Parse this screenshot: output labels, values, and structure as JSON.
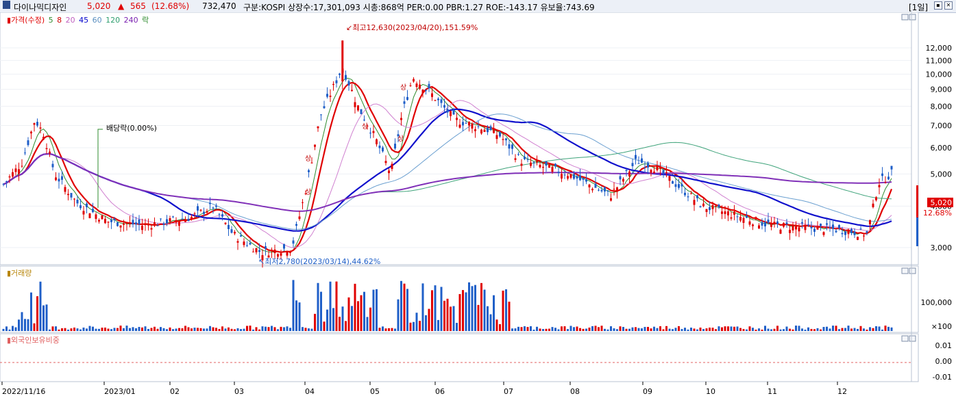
{
  "header": {
    "name": "다이나믹디자인",
    "price": "5,020",
    "change_arrow": "▲",
    "change": "565",
    "change_pct": "(12.68%)",
    "volume": "732,470",
    "info": "구분:KOSPI 상장수:17,301,093 시총:868억 PER:0.00 PBR:1.27 ROE:-143.17 유보율:743.69",
    "period": "[1일]",
    "up_color": "#e00000"
  },
  "legend": {
    "price_marker": "▮",
    "price_label": "가격(수정)",
    "ma": [
      {
        "label": "5",
        "color": "#2e8b2e"
      },
      {
        "label": "8",
        "color": "#d00000"
      },
      {
        "label": "20",
        "color": "#c060c0"
      },
      {
        "label": "45",
        "color": "#0000cc"
      },
      {
        "label": "60",
        "color": "#5a8fc0"
      },
      {
        "label": "120",
        "color": "#2e9e6e"
      },
      {
        "label": "240",
        "color": "#7a20b0"
      }
    ],
    "rak": "락"
  },
  "annotations": {
    "high": "↙최고12,630(2023/04/20),151.59%",
    "low": "↖최저2,780(2023/03/14),44.62%",
    "dividend": "배당락(0.00%)",
    "sang": "상"
  },
  "volume_panel": {
    "title": "▮거래량",
    "ticks": [
      "100,000"
    ],
    "unit": "×100"
  },
  "foreign_panel": {
    "title": "▮외국인보유비중",
    "ticks": [
      "0.01",
      "0.00",
      "-0.01"
    ]
  },
  "price_axis": [
    "12,000",
    "11,000",
    "10,000",
    "9,000",
    "8,000",
    "7,000",
    "6,000",
    "5,000",
    "4,000",
    "3,000"
  ],
  "price_tag": {
    "value": "5,020",
    "pct": "12.68%"
  },
  "x_axis": [
    "2022/11/16",
    "2023/01",
    "02",
    "03",
    "04",
    "05",
    "06",
    "07",
    "08",
    "09",
    "10",
    "11",
    "12"
  ],
  "chart_data": {
    "type": "candlestick",
    "title": "다이나믹디자인",
    "period": "1일",
    "y_range": [
      2600,
      12900
    ],
    "y_scale": "log",
    "x": [
      "2022/11/16",
      "2023/01",
      "02",
      "03",
      "04",
      "05",
      "06",
      "07",
      "08",
      "09",
      "10",
      "11",
      "12"
    ],
    "close_path": [
      [
        "2022/11/16",
        4600
      ],
      [
        "2022/11/25",
        5400
      ],
      [
        "2022/12/01",
        7300
      ],
      [
        "2022/12/05",
        6600
      ],
      [
        "2022/12/10",
        5000
      ],
      [
        "2022/12/20",
        4100
      ],
      [
        "2023/01/03",
        3600
      ],
      [
        "2023/01/20",
        3500
      ],
      [
        "2023/02/10",
        3700
      ],
      [
        "2023/02/20",
        4000
      ],
      [
        "2023/03/01",
        3300
      ],
      [
        "2023/03/14",
        2900
      ],
      [
        "2023/03/28",
        3000
      ],
      [
        "2023/04/03",
        4400
      ],
      [
        "2023/04/10",
        7500
      ],
      [
        "2023/04/20",
        10500
      ],
      [
        "2023/04/27",
        8000
      ],
      [
        "2023/05/05",
        6400
      ],
      [
        "2023/05/12",
        5000
      ],
      [
        "2023/05/17",
        7500
      ],
      [
        "2023/05/22",
        9800
      ],
      [
        "2023/05/30",
        8800
      ],
      [
        "2023/06/10",
        7300
      ],
      [
        "2023/06/25",
        6800
      ],
      [
        "2023/07/01",
        6500
      ],
      [
        "2023/07/10",
        5500
      ],
      [
        "2023/08/01",
        5000
      ],
      [
        "2023/08/20",
        4300
      ],
      [
        "2023/09/01",
        5500
      ],
      [
        "2023/09/10",
        5200
      ],
      [
        "2023/10/01",
        4000
      ],
      [
        "2023/11/01",
        3500
      ],
      [
        "2023/12/01",
        3400
      ],
      [
        "2023/12/15",
        3300
      ],
      [
        "2023/12/20",
        4700
      ],
      [
        "2023/12/26",
        5020
      ]
    ],
    "high": {
      "value": 12630,
      "date": "2023/04/20",
      "pct": 151.59
    },
    "low": {
      "value": 2780,
      "date": "2023/03/14",
      "pct": 44.62
    },
    "last": {
      "value": 5020,
      "change": 565,
      "change_pct": 12.68
    },
    "moving_averages": [
      "5",
      "8",
      "20",
      "45",
      "60",
      "120",
      "240"
    ]
  }
}
